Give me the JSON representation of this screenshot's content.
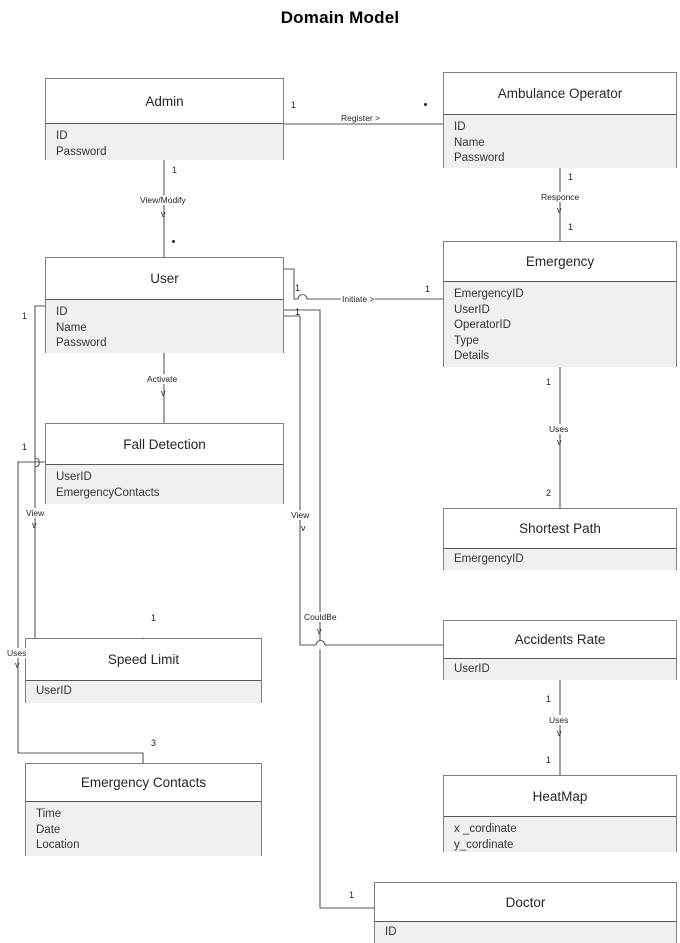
{
  "title": "Domain Model",
  "entities": [
    {
      "id": "admin",
      "name": "Admin",
      "attributes": [
        "ID",
        "Password"
      ]
    },
    {
      "id": "ambulance_operator",
      "name": "Ambulance Operator",
      "attributes": [
        "ID",
        "Name",
        "Password"
      ]
    },
    {
      "id": "user",
      "name": "User",
      "attributes": [
        "ID",
        "Name",
        "Password"
      ]
    },
    {
      "id": "emergency",
      "name": "Emergency",
      "attributes": [
        "EmergencyID",
        "UserID",
        "OperatorID",
        "Type",
        "Details"
      ]
    },
    {
      "id": "fall_detection",
      "name": "Fall Detection",
      "attributes": [
        "UserID",
        "EmergencyContacts"
      ]
    },
    {
      "id": "shortest_path",
      "name": "Shortest Path",
      "attributes": [
        "EmergencyID"
      ]
    },
    {
      "id": "speed_limit",
      "name": "Speed Limit",
      "attributes": [
        "UserID"
      ]
    },
    {
      "id": "accidents_rate",
      "name": "Accidents Rate",
      "attributes": [
        "UserID"
      ]
    },
    {
      "id": "emergency_contacts",
      "name": "Emergency Contacts",
      "attributes": [
        "Time",
        "Date",
        "Location"
      ]
    },
    {
      "id": "heatmap",
      "name": "HeatMap",
      "attributes": [
        "x _cordinate",
        "y_cordinate"
      ]
    },
    {
      "id": "doctor",
      "name": "Doctor",
      "attributes": [
        "ID"
      ]
    }
  ],
  "relationships": [
    {
      "id": "register",
      "label": "Register >",
      "from": "admin",
      "to": "ambulance_operator",
      "from_mult": "1",
      "to_mult": "*"
    },
    {
      "id": "view_modify",
      "label": "View/Modify",
      "from": "admin",
      "to": "user",
      "from_mult": "1",
      "to_mult": "*"
    },
    {
      "id": "responce",
      "label": "Responce",
      "from": "ambulance_operator",
      "to": "emergency",
      "from_mult": "1",
      "to_mult": "1"
    },
    {
      "id": "initiate",
      "label": "Initiate >",
      "from": "user",
      "to": "emergency",
      "from_mult": "1",
      "to_mult": "1"
    },
    {
      "id": "activate",
      "label": "Activate",
      "from": "user",
      "to": "fall_detection",
      "from_mult": "",
      "to_mult": ""
    },
    {
      "id": "view_speed_limit",
      "label": "View",
      "from": "user",
      "to": "speed_limit",
      "from_mult": "1",
      "to_mult": "1"
    },
    {
      "id": "uses_emergency_contacts",
      "label": "Uses",
      "from": "fall_detection",
      "to": "emergency_contacts",
      "from_mult": "1",
      "to_mult": "3"
    },
    {
      "id": "view_accidents_rate",
      "label": "View",
      "from": "user",
      "to": "accidents_rate",
      "from_mult": "1",
      "to_mult": ""
    },
    {
      "id": "couldbe_doctor",
      "label": "CouldBe",
      "from": "user",
      "to": "doctor",
      "from_mult": "1",
      "to_mult": "1"
    },
    {
      "id": "uses_shortest_path",
      "label": "Uses",
      "from": "emergency",
      "to": "shortest_path",
      "from_mult": "1",
      "to_mult": "2"
    },
    {
      "id": "uses_heatmap",
      "label": "Uses",
      "from": "accidents_rate",
      "to": "heatmap",
      "from_mult": "1",
      "to_mult": "1"
    }
  ],
  "edge_labels": {
    "register": "Register >",
    "view_modify": "View/Modify",
    "responce": "Responce",
    "initiate": "Initiate >",
    "activate": "Activate",
    "uses_shortest_path": "Uses",
    "view_left": "View",
    "uses_left": "Uses",
    "view_mid": "View",
    "couldbe": "CouldBe",
    "uses_heatmap": "Uses"
  },
  "multiplicities": {
    "admin_right": "1",
    "operator_left": "*",
    "admin_bottom": "1",
    "user_top": "*",
    "operator_bottom": "1",
    "emergency_top": "1",
    "user_right_initiate": "1",
    "emergency_left": "1",
    "user_right_lower": "1",
    "user_left_speed": "1",
    "falldet_left": "1",
    "speedlimit_top": "1",
    "emgcontacts_top": "3",
    "emergency_bottom": "1",
    "shortestpath_top": "2",
    "accidents_bottom": "1",
    "heatmap_top": "1",
    "doctor_left": "1"
  },
  "colors": {
    "border": "#7f7f7f",
    "header_divider": "#595959",
    "body_fill": "#f0f0f0",
    "header_fill": "#ffffff",
    "line": "#595959",
    "text": "#262626",
    "title": "#000000"
  }
}
